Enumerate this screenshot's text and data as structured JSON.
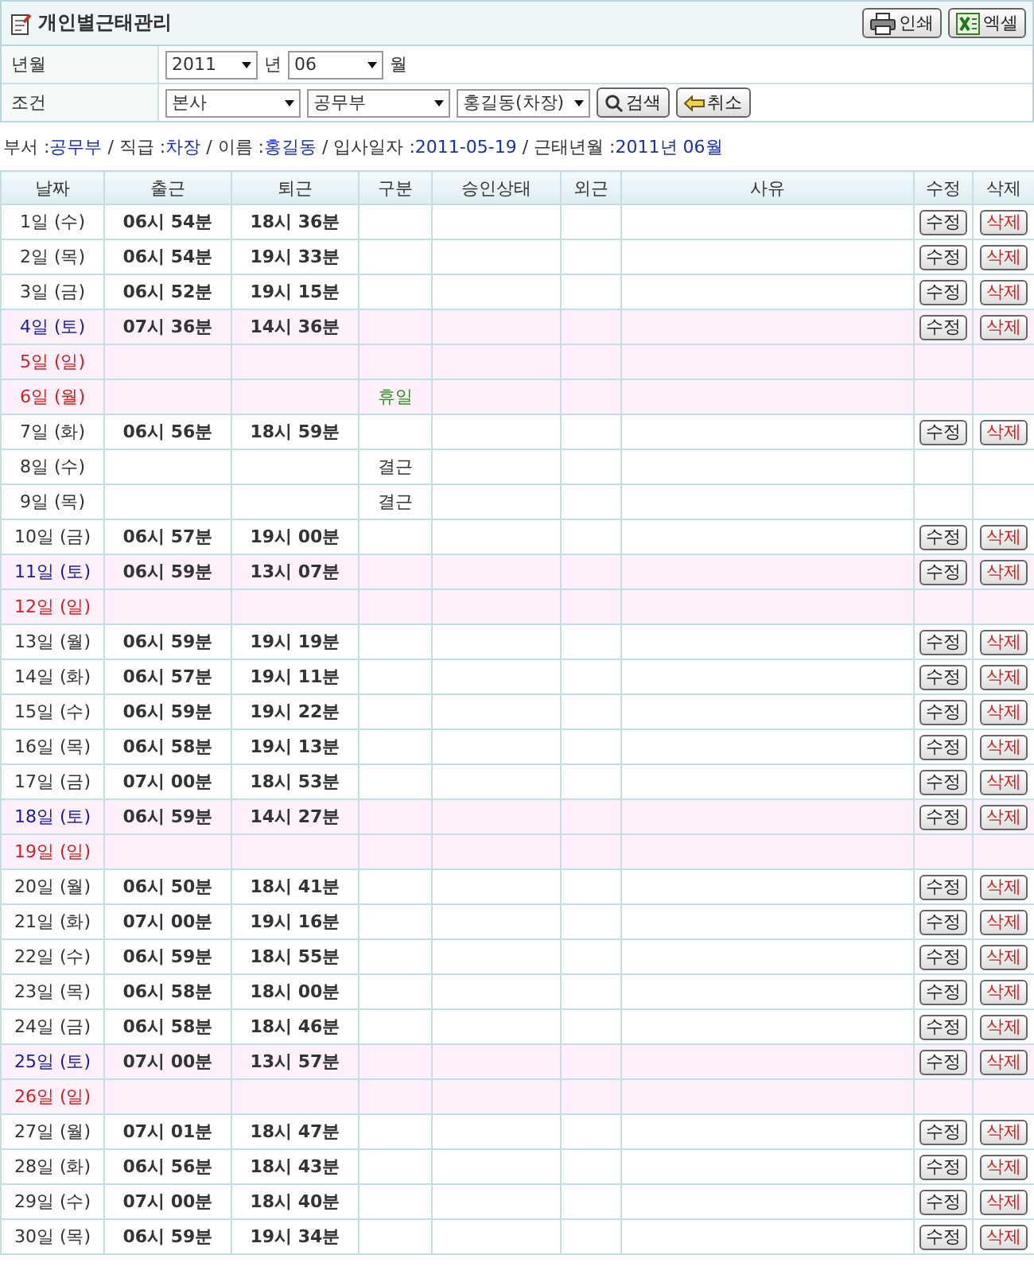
{
  "title": "개인별근태관리",
  "toolbar": [
    {
      "kind": "print",
      "label": "인쇄"
    },
    {
      "kind": "excel",
      "label": "엑셀"
    }
  ],
  "filters": [
    {
      "label": "년월",
      "controls": [
        {
          "kind": "select",
          "value": "2011"
        },
        {
          "kind": "text",
          "value": "년"
        },
        {
          "kind": "select",
          "value": "06"
        },
        {
          "kind": "text",
          "value": "월"
        }
      ]
    },
    {
      "label": "조건",
      "controls": [
        {
          "kind": "select",
          "value": "본사"
        },
        {
          "kind": "select",
          "value": "공무부"
        },
        {
          "kind": "select",
          "value": "홍길동(차장)"
        },
        {
          "kind": "search",
          "value": "검색"
        },
        {
          "kind": "cancel",
          "value": "취소"
        }
      ]
    }
  ],
  "info": {
    "separator": "/",
    "items": [
      {
        "label": "부서 :",
        "value": "공무부"
      },
      {
        "label": "직급 :",
        "value": "차장"
      },
      {
        "label": "이름 :",
        "value": "홍길동"
      },
      {
        "label": "입사일자 :",
        "value": "2011-05-19"
      },
      {
        "label": "근태년월 :",
        "value": "2011년 06월"
      }
    ]
  },
  "table": {
    "columns": [
      "날짜",
      "출근",
      "퇴근",
      "구분",
      "승인상태",
      "외근",
      "사유",
      "수정",
      "삭제"
    ],
    "rows": [
      {
        "date": "1일 (수)",
        "kind": "weekday",
        "in": "06시 54분",
        "out": "18시 36분",
        "edit": "수정",
        "delete": "삭제"
      },
      {
        "date": "2일 (목)",
        "kind": "weekday",
        "in": "06시 54분",
        "out": "19시 33분",
        "edit": "수정",
        "delete": "삭제"
      },
      {
        "date": "3일 (금)",
        "kind": "weekday",
        "in": "06시 52분",
        "out": "19시 15분",
        "edit": "수정",
        "delete": "삭제"
      },
      {
        "date": "4일 (토)",
        "kind": "saturday",
        "in": "07시 36분",
        "out": "14시 36분",
        "edit": "수정",
        "delete": "삭제"
      },
      {
        "date": "5일 (일)",
        "kind": "sunday"
      },
      {
        "date": "6일 (월)",
        "kind": "sunday",
        "status": "휴일",
        "color": "#3a8a2a"
      },
      {
        "date": "7일 (화)",
        "kind": "weekday",
        "in": "06시 56분",
        "out": "18시 59분",
        "edit": "수정",
        "delete": "삭제"
      },
      {
        "date": "8일 (수)",
        "kind": "weekday",
        "status": "결근",
        "color": "#333333"
      },
      {
        "date": "9일 (목)",
        "kind": "weekday",
        "status": "결근",
        "color": "#333333"
      },
      {
        "date": "10일 (금)",
        "kind": "weekday",
        "in": "06시 57분",
        "out": "19시 00분",
        "edit": "수정",
        "delete": "삭제"
      },
      {
        "date": "11일 (토)",
        "kind": "saturday",
        "in": "06시 59분",
        "out": "13시 07분",
        "edit": "수정",
        "delete": "삭제"
      },
      {
        "date": "12일 (일)",
        "kind": "sunday"
      },
      {
        "date": "13일 (월)",
        "kind": "weekday",
        "in": "06시 59분",
        "out": "19시 19분",
        "edit": "수정",
        "delete": "삭제"
      },
      {
        "date": "14일 (화)",
        "kind": "weekday",
        "in": "06시 57분",
        "out": "19시 11분",
        "edit": "수정",
        "delete": "삭제"
      },
      {
        "date": "15일 (수)",
        "kind": "weekday",
        "in": "06시 59분",
        "out": "19시 22분",
        "edit": "수정",
        "delete": "삭제"
      },
      {
        "date": "16일 (목)",
        "kind": "weekday",
        "in": "06시 58분",
        "out": "19시 13분",
        "edit": "수정",
        "delete": "삭제"
      },
      {
        "date": "17일 (금)",
        "kind": "weekday",
        "in": "07시 00분",
        "out": "18시 53분",
        "edit": "수정",
        "delete": "삭제"
      },
      {
        "date": "18일 (토)",
        "kind": "saturday",
        "in": "06시 59분",
        "out": "14시 27분",
        "edit": "수정",
        "delete": "삭제"
      },
      {
        "date": "19일 (일)",
        "kind": "sunday"
      },
      {
        "date": "20일 (월)",
        "kind": "weekday",
        "in": "06시 50분",
        "out": "18시 41분",
        "edit": "수정",
        "delete": "삭제"
      },
      {
        "date": "21일 (화)",
        "kind": "weekday",
        "in": "07시 00분",
        "out": "19시 16분",
        "edit": "수정",
        "delete": "삭제"
      },
      {
        "date": "22일 (수)",
        "kind": "weekday",
        "in": "06시 59분",
        "out": "18시 55분",
        "edit": "수정",
        "delete": "삭제"
      },
      {
        "date": "23일 (목)",
        "kind": "weekday",
        "in": "06시 58분",
        "out": "18시 00분",
        "edit": "수정",
        "delete": "삭제"
      },
      {
        "date": "24일 (금)",
        "kind": "weekday",
        "in": "06시 58분",
        "out": "18시 46분",
        "edit": "수정",
        "delete": "삭제"
      },
      {
        "date": "25일 (토)",
        "kind": "saturday",
        "in": "07시 00분",
        "out": "13시 57분",
        "edit": "수정",
        "delete": "삭제"
      },
      {
        "date": "26일 (일)",
        "kind": "sunday"
      },
      {
        "date": "27일 (월)",
        "kind": "weekday",
        "in": "07시 01분",
        "out": "18시 47분",
        "edit": "수정",
        "delete": "삭제"
      },
      {
        "date": "28일 (화)",
        "kind": "weekday",
        "in": "06시 56분",
        "out": "18시 43분",
        "edit": "수정",
        "delete": "삭제"
      },
      {
        "date": "29일 (수)",
        "kind": "weekday",
        "in": "07시 00분",
        "out": "18시 40분",
        "edit": "수정",
        "delete": "삭제"
      },
      {
        "date": "30일 (목)",
        "kind": "weekday",
        "in": "06시 59분",
        "out": "19시 34분",
        "edit": "수정",
        "delete": "삭제"
      }
    ]
  }
}
